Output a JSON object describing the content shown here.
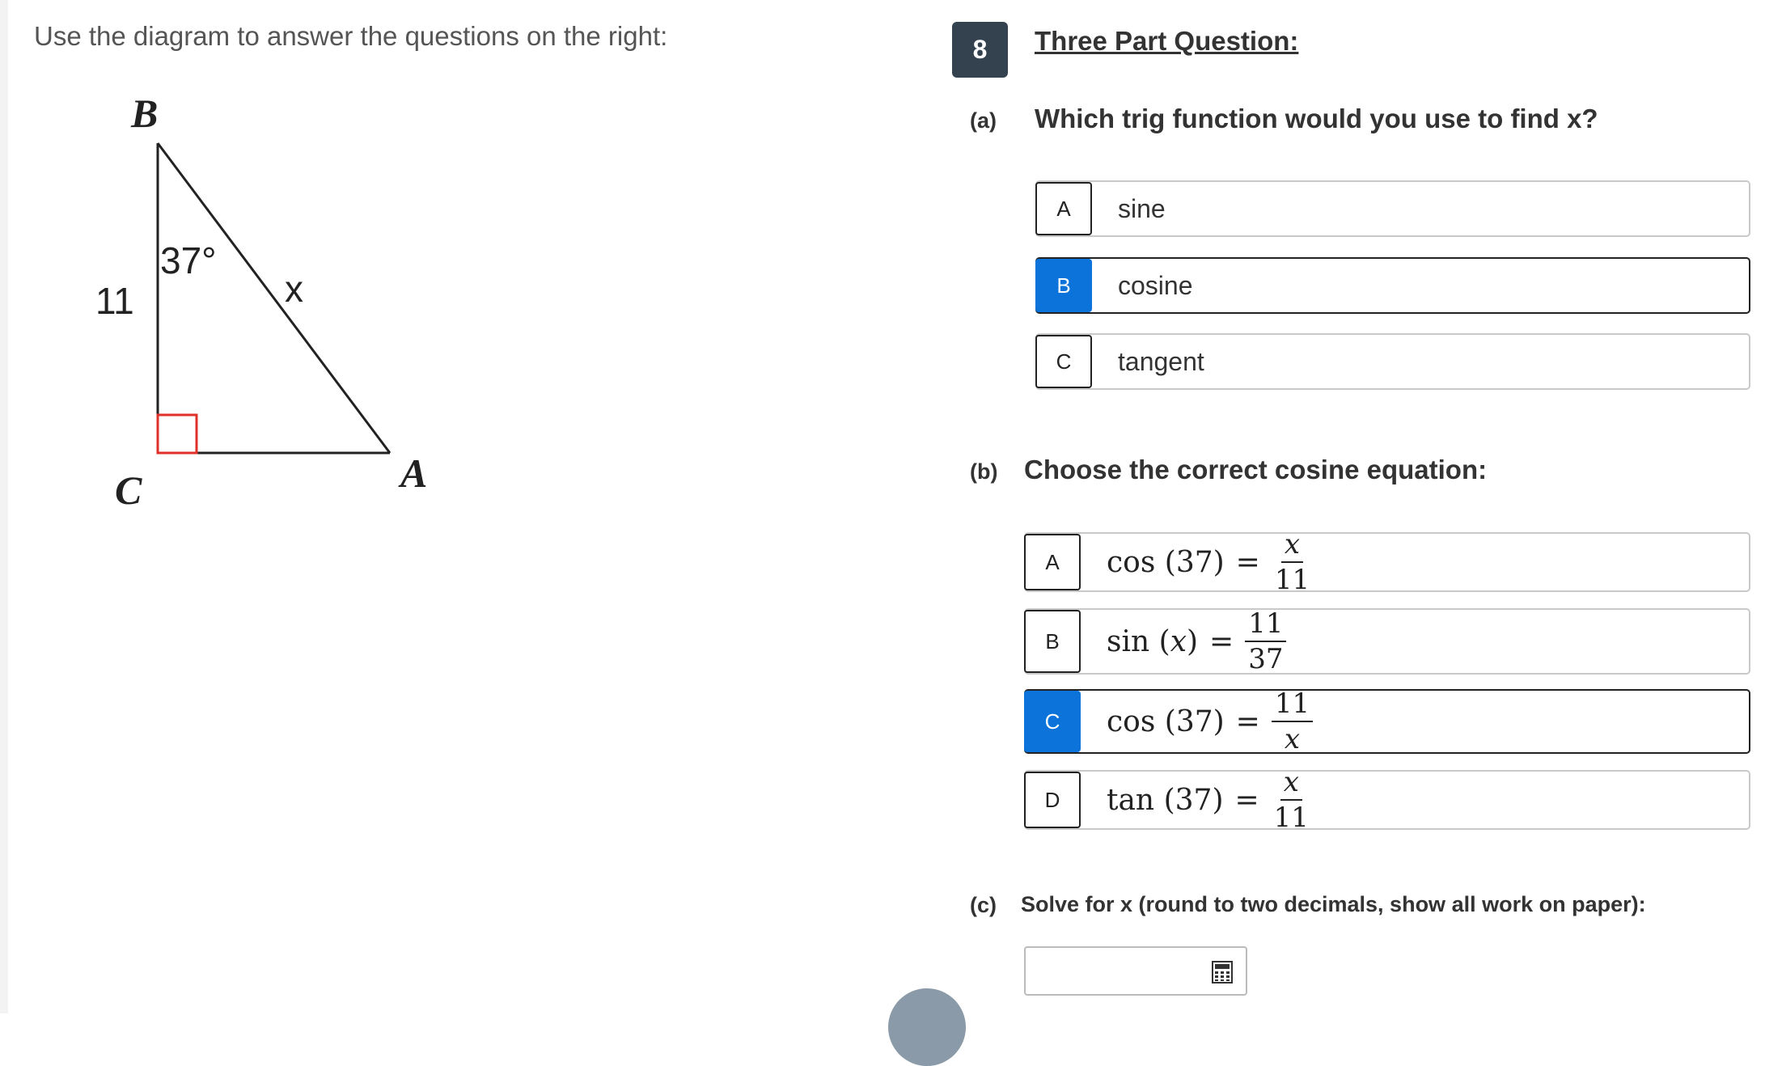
{
  "instructions": "Use the diagram to answer the questions on the right:",
  "diagram": {
    "vertex_b": "B",
    "vertex_c": "C",
    "vertex_a": "A",
    "angle_label": "37°",
    "side_label_left": "11",
    "side_label_hyp": "x"
  },
  "question": {
    "number": "8",
    "title": "Three Part Question:",
    "part_a": {
      "label": "(a)",
      "text": "Which trig function would you use to find x?",
      "options": [
        {
          "letter": "A",
          "text": "sine"
        },
        {
          "letter": "B",
          "text": "cosine",
          "selected": true
        },
        {
          "letter": "C",
          "text": "tangent"
        }
      ]
    },
    "part_b": {
      "label": "(b)",
      "text": "Choose the correct cosine equation:",
      "options": [
        {
          "letter": "A",
          "func": "cos",
          "arg": "37",
          "num": "x",
          "den": "11"
        },
        {
          "letter": "B",
          "func": "sin",
          "arg": "x",
          "num": "11",
          "den": "37"
        },
        {
          "letter": "C",
          "func": "cos",
          "arg": "37",
          "num": "11",
          "den": "x",
          "selected": true
        },
        {
          "letter": "D",
          "func": "tan",
          "arg": "37",
          "num": "x",
          "den": "11"
        }
      ]
    },
    "part_c": {
      "label": "(c)",
      "text": "Solve for x (round to two decimals, show all work on paper):",
      "answer_value": ""
    }
  },
  "icons": {
    "calculator": "calculator-icon"
  },
  "colors": {
    "selected": "#0b73da",
    "badge": "#34424f",
    "right_angle": "#e0302a"
  }
}
